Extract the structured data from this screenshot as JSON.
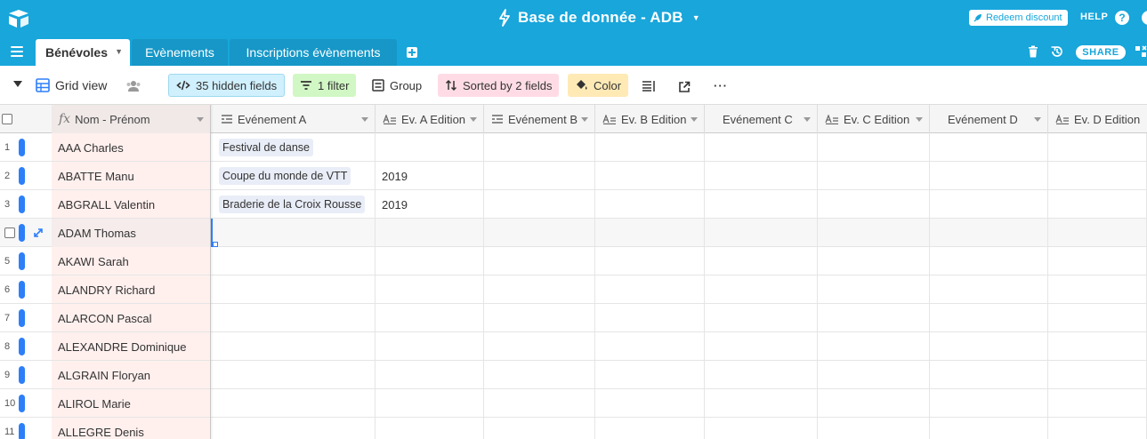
{
  "topbar": {
    "base_title": "Base de donnée - ADB",
    "redeem_label": "Redeem discount",
    "help_label": "HELP",
    "help_icon_glyph": "?"
  },
  "tabs": [
    {
      "label": "Bénévoles",
      "active": true
    },
    {
      "label": "Evènements",
      "active": false
    },
    {
      "label": "Inscriptions évènements",
      "active": false
    }
  ],
  "tabbar": {
    "share_label": "SHARE"
  },
  "toolbar": {
    "view_name": "Grid view",
    "hidden_fields": "35 hidden fields",
    "filter": "1 filter",
    "group": "Group",
    "sorted": "Sorted by 2 fields",
    "color": "Color",
    "more": "···"
  },
  "grid": {
    "columns": [
      {
        "label": "Nom - Prénom",
        "type": "formula"
      },
      {
        "label": "Evénement A",
        "type": "link"
      },
      {
        "label": "Ev. A Edition",
        "type": "text"
      },
      {
        "label": "Evénement B",
        "type": "link"
      },
      {
        "label": "Ev. B Edition",
        "type": "text"
      },
      {
        "label": "Evénement C",
        "type": "link"
      },
      {
        "label": "Ev. C Edition",
        "type": "text"
      },
      {
        "label": "Evénement D",
        "type": "link"
      },
      {
        "label": "Ev. D Edition",
        "type": "text"
      }
    ],
    "rows": [
      {
        "num": "1",
        "name": "AAA Charles",
        "event_a": "Festival de danse",
        "ev_a_edition": ""
      },
      {
        "num": "2",
        "name": "ABATTE Manu",
        "event_a": "Coupe du monde de VTT",
        "ev_a_edition": "2019"
      },
      {
        "num": "3",
        "name": "ABGRALL Valentin",
        "event_a": "Braderie de la Croix Rousse",
        "ev_a_edition": "2019"
      },
      {
        "num": "",
        "name": "ADAM Thomas",
        "event_a": "",
        "ev_a_edition": ""
      },
      {
        "num": "5",
        "name": "AKAWI Sarah",
        "event_a": "",
        "ev_a_edition": ""
      },
      {
        "num": "6",
        "name": "ALANDRY Richard",
        "event_a": "",
        "ev_a_edition": ""
      },
      {
        "num": "7",
        "name": "ALARCON Pascal",
        "event_a": "",
        "ev_a_edition": ""
      },
      {
        "num": "8",
        "name": "ALEXANDRE Dominique",
        "event_a": "",
        "ev_a_edition": ""
      },
      {
        "num": "9",
        "name": "ALGRAIN Floryan",
        "event_a": "",
        "ev_a_edition": ""
      },
      {
        "num": "10",
        "name": "ALIROL Marie",
        "event_a": "",
        "ev_a_edition": ""
      },
      {
        "num": "11",
        "name": "ALLEGRE Denis",
        "event_a": "",
        "ev_a_edition": ""
      }
    ]
  },
  "colors": {
    "brand": "#18a6db",
    "row_color": "#2d7ff9",
    "hidden_fields_bg": "#d0f0fd",
    "filter_bg": "#d1f7c4",
    "sorted_bg": "#ffdce5",
    "color_bg": "#ffeab6"
  }
}
